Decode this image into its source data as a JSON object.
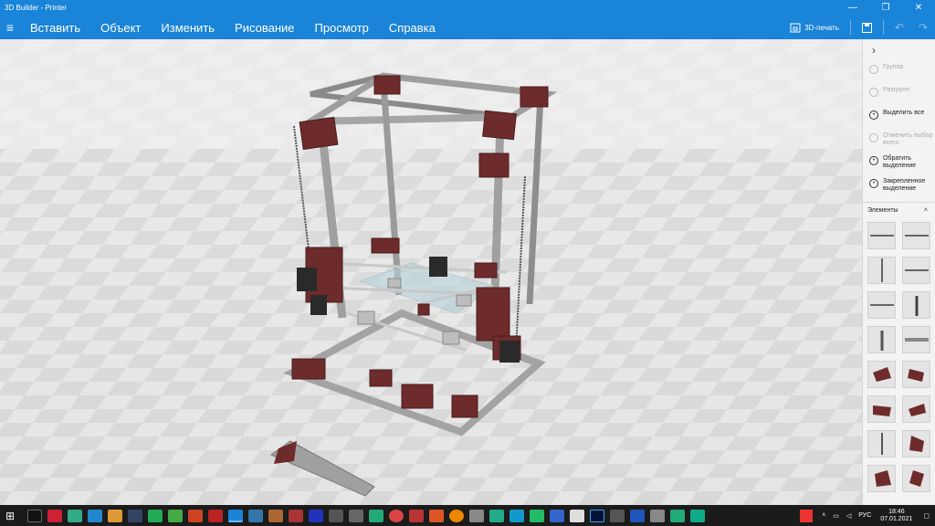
{
  "window": {
    "title": "3D Builder - Printer",
    "controls": [
      "—",
      "❐",
      "✕"
    ]
  },
  "menu": {
    "items": [
      "Вставить",
      "Объект",
      "Изменить",
      "Рисование",
      "Просмотр",
      "Справка"
    ],
    "print_label": "3D-печать"
  },
  "panel": {
    "commands": [
      {
        "label": "Группа",
        "enabled": false
      },
      {
        "label": "Разгрупп.",
        "enabled": false
      },
      {
        "label": "Выделить все",
        "enabled": true
      },
      {
        "label": "Отменить выбор всего",
        "enabled": false
      },
      {
        "label": "Обратить выделение",
        "enabled": true
      },
      {
        "label": "Закрепленное выделение",
        "enabled": true
      }
    ],
    "elements_header": "Элементы"
  },
  "taskbar": {
    "lang": "РУС",
    "time": "18:46",
    "date": "07.01.2021"
  },
  "colors": {
    "accent": "#1a84d8",
    "frame_bracket": "#6e2b2b",
    "rail": "#9a9a9a"
  }
}
